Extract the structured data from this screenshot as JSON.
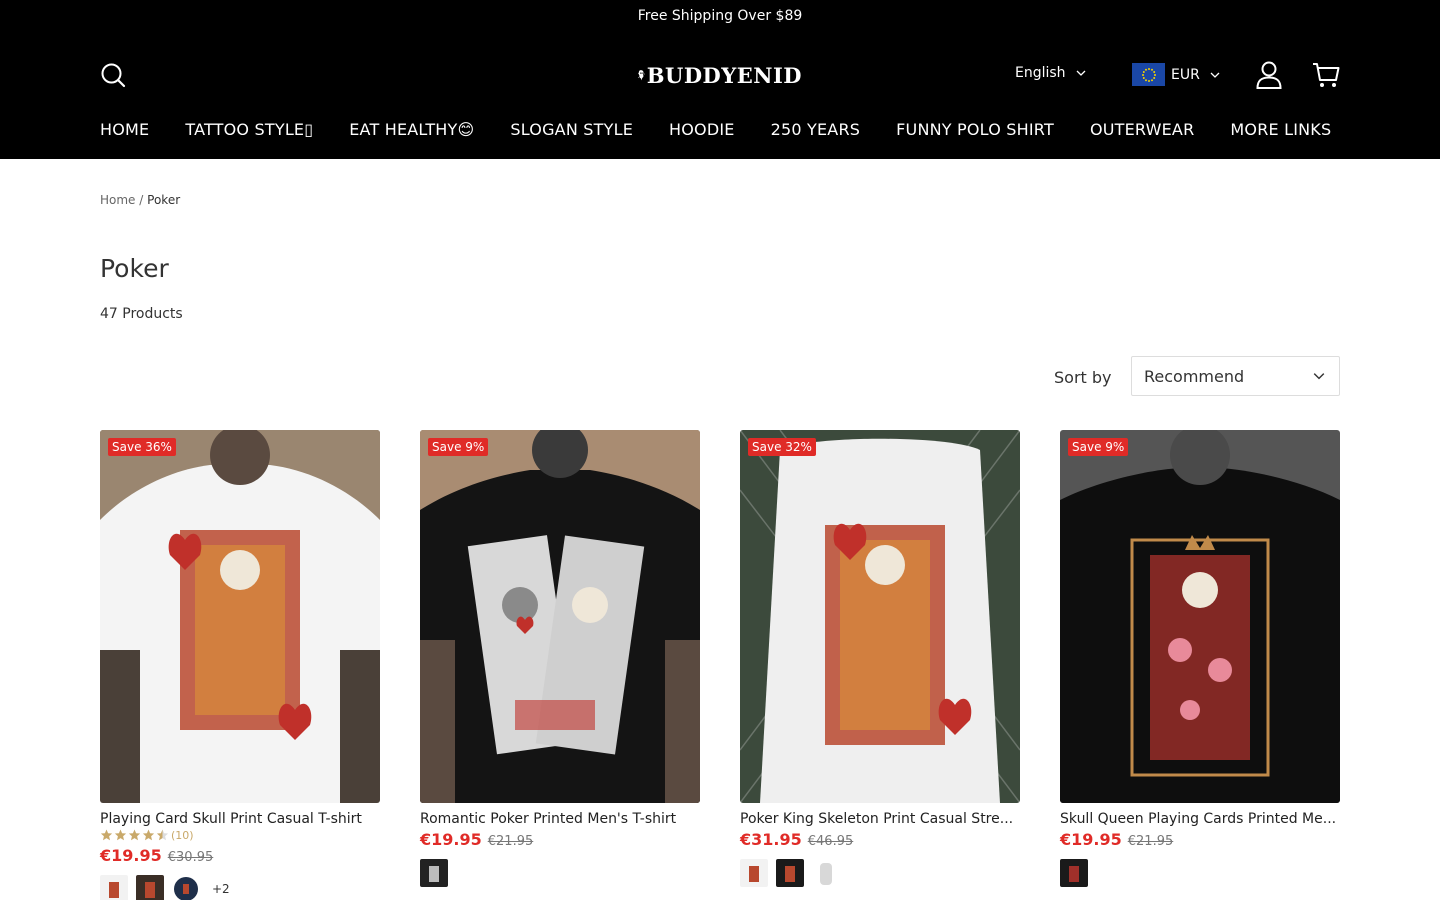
{
  "announcement": "Free Shipping Over $89",
  "brand": {
    "name": "BUDDYENID"
  },
  "header": {
    "language": "English",
    "currency": "EUR",
    "icons": {
      "search": "search-icon",
      "account": "user-icon",
      "cart": "cart-icon"
    }
  },
  "nav": {
    "items": [
      {
        "label": "HOME"
      },
      {
        "label": "TATTOO STYLE▯"
      },
      {
        "label": "EAT HEALTHY😊"
      },
      {
        "label": "SLOGAN STYLE"
      },
      {
        "label": "HOODIE"
      },
      {
        "label": "250 YEARS"
      },
      {
        "label": "FUNNY POLO SHIRT"
      },
      {
        "label": "OUTERWEAR"
      },
      {
        "label": "MORE LINKS"
      }
    ]
  },
  "breadcrumb": {
    "home": "Home",
    "separator": "/",
    "current": "Poker"
  },
  "collection": {
    "title": "Poker",
    "count": "47 Products"
  },
  "sort": {
    "label": "Sort by",
    "value": "Recommend"
  },
  "colors": {
    "accent": "#e02b27",
    "header_bg": "#000000",
    "star": "#c9a96a"
  },
  "products": [
    {
      "badge": "Save 36%",
      "title": "Playing Card Skull Print Casual T-shirt",
      "rating": 4.5,
      "rating_count": "(10)",
      "price": "€19.95",
      "old_price": "€30.95",
      "swatches_more": "+2"
    },
    {
      "badge": "Save 9%",
      "title": "Romantic Poker Printed Men's T-shirt",
      "price": "€19.95",
      "old_price": "€21.95"
    },
    {
      "badge": "Save 32%",
      "title": "Poker King Skeleton Print Casual Stre...",
      "price": "€31.95",
      "old_price": "€46.95"
    },
    {
      "badge": "Save 9%",
      "title": "Skull Queen Playing Cards Printed Me...",
      "price": "€19.95",
      "old_price": "€21.95"
    }
  ]
}
